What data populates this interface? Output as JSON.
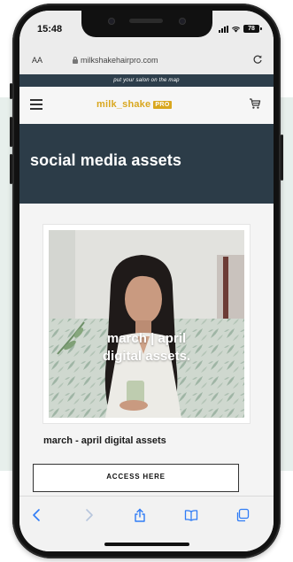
{
  "status_bar": {
    "time": "15:48",
    "battery_level": "78"
  },
  "browser": {
    "text_size_label": "AA",
    "url": "milkshakehairpro.com"
  },
  "promo": {
    "text": "put your salon on the map"
  },
  "header": {
    "logo_text": "milk_shake",
    "logo_badge": "PRO"
  },
  "page": {
    "title": "social media assets"
  },
  "card": {
    "overlay_line1": "march | april",
    "overlay_line2": "digital assets.",
    "title": "march - april digital assets",
    "button_label": "ACCESS HERE"
  },
  "toolbar": {
    "items": [
      "back",
      "forward",
      "share",
      "bookmarks",
      "tabs"
    ]
  },
  "colors": {
    "brand_gold": "#d9a71f",
    "navy": "#2c3c48",
    "ios_blue": "#2f7cf6",
    "bg_mint": "#e7efec"
  }
}
